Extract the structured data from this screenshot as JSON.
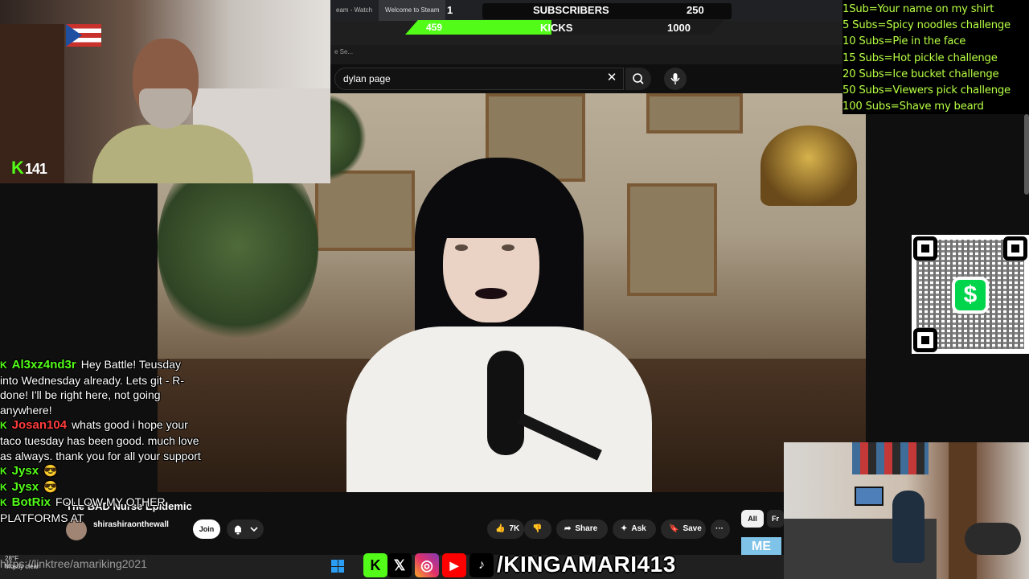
{
  "browser": {
    "tabs": [
      {
        "label": "eam - Watch"
      },
      {
        "label": "Welcome to Steam"
      },
      {
        "label": "1"
      }
    ],
    "address_hint": "e Se..."
  },
  "search": {
    "query": "dylan page"
  },
  "goals": {
    "subscribers": {
      "label": "SUBSCRIBERS",
      "current": "1",
      "target": "250"
    },
    "kicks": {
      "label": "KICKS",
      "current": "459",
      "target": "1000",
      "progress": 0.459
    }
  },
  "webcam": {
    "viewer_count": "141",
    "platform_glyph": "K"
  },
  "rules": [
    "1Sub=Your name on my shirt",
    "5 Subs=Spicy noodles challenge",
    "10 Subs=Pie in the face",
    "15 Subs=Hot pickle challenge",
    "20 Subs=Ice bucket challenge",
    "50 Subs=Viewers pick challenge",
    "100 Subs=Shave my beard"
  ],
  "qr": {
    "glyph": "$"
  },
  "chat": [
    {
      "user": "Al3xz4nd3r",
      "color": "#53fc18",
      "text": "Hey Battle! Teusday into Wednesday already. Lets git - R- done! I'll be right here, not going anywhere!"
    },
    {
      "user": "Josan104",
      "color": "#ff3c3c",
      "text": "whats good i hope your taco tuesday has been good. much love as always. thank you for all your support"
    },
    {
      "user": "Jysx",
      "color": "#53fc18",
      "text": "😎"
    },
    {
      "user": "Jysx",
      "color": "#53fc18",
      "text": "😎"
    },
    {
      "user": "BotRix",
      "color": "#53fc18",
      "text": "FOLLOW MY OTHER PLATFORMS AT"
    }
  ],
  "youtube": {
    "video_title": "The BAD Nurse Epidemic",
    "channel_name": "shirashiraonthewall",
    "join_label": "Join",
    "like_count": "7K",
    "share_label": "Share",
    "ask_label": "Ask",
    "save_label": "Save",
    "chip_all": "All",
    "chip_next": "Fr"
  },
  "taskbar": {
    "weather_temp": "28°F",
    "weather_desc": "Mostly clear",
    "link_overlay": "https://linktree/amariking2021",
    "handle": "/KINGAMARI413",
    "me_badge": "ME"
  },
  "colors": {
    "kick_green": "#53fc18",
    "rules_text": "#b6ff44",
    "youtube_bg": "#0f0f0f"
  }
}
